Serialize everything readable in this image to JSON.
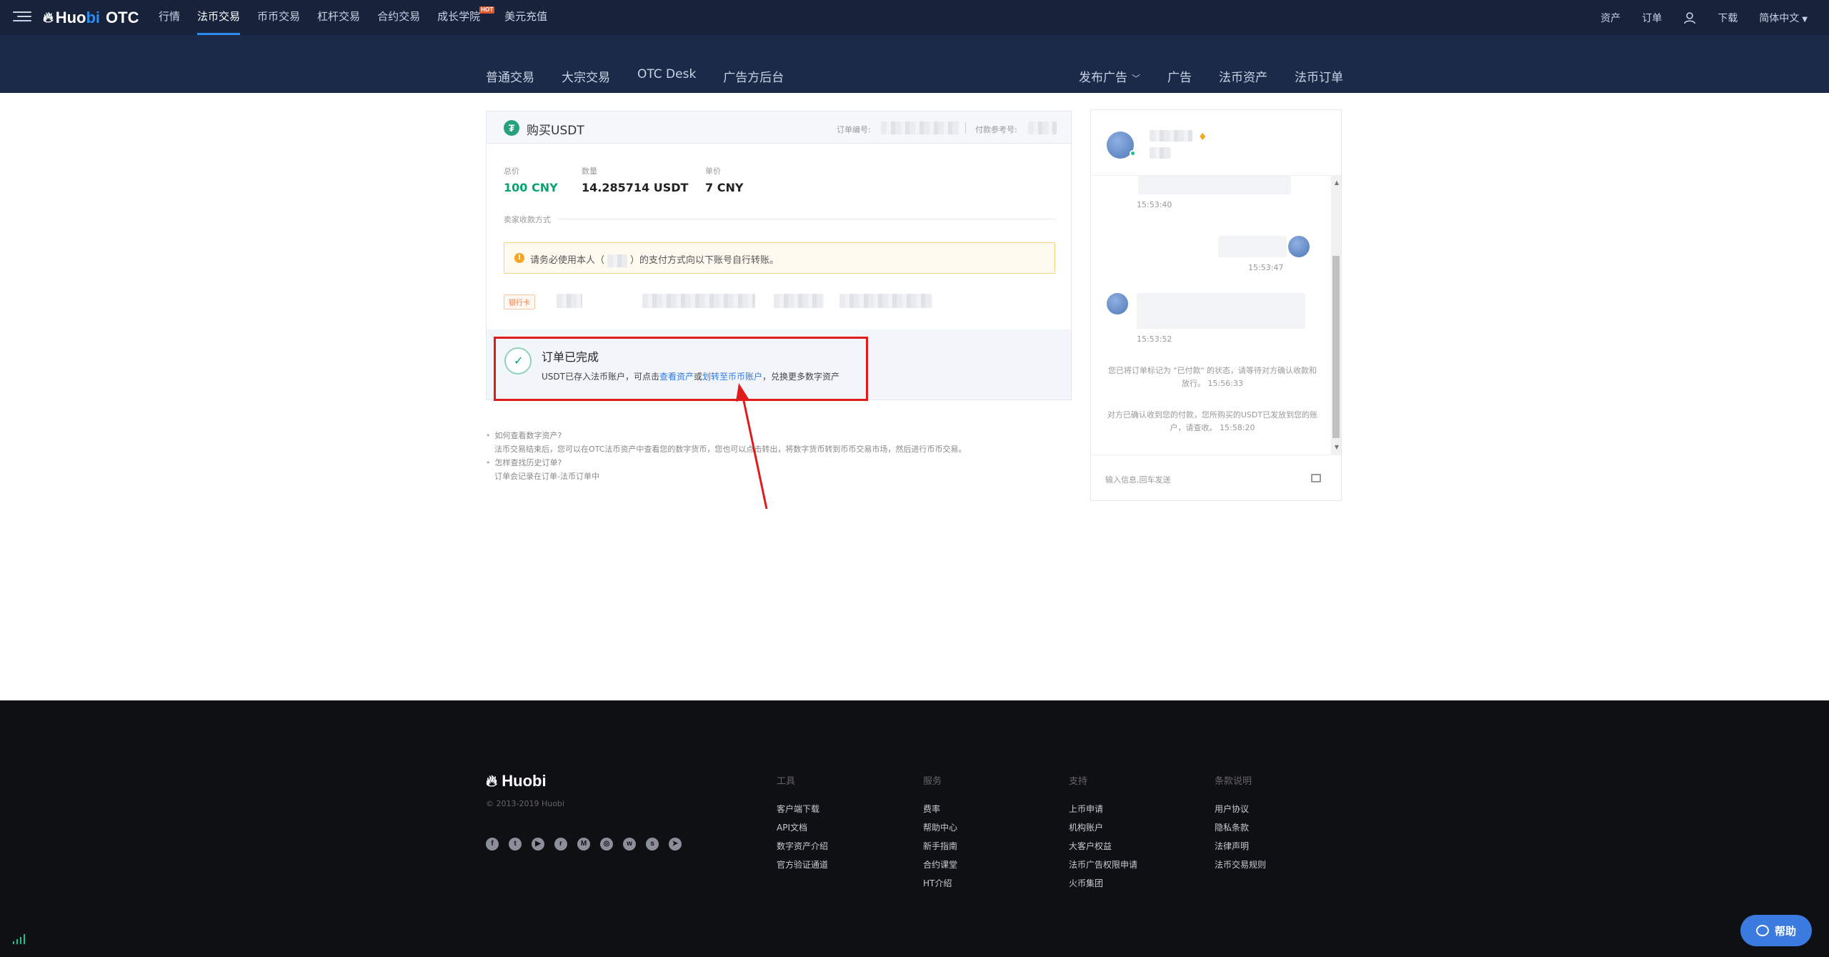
{
  "topnav": {
    "logo_main": "Huo",
    "logo_accent": "bi",
    "logo_suffix": "OTC",
    "items": [
      "行情",
      "法币交易",
      "币币交易",
      "杠杆交易",
      "合约交易",
      "成长学院",
      "美元充值"
    ],
    "hot_badge": "HOT",
    "right": {
      "assets": "资产",
      "orders": "订单",
      "download": "下载",
      "language": "简体中文"
    }
  },
  "subnav": {
    "left": [
      "普通交易",
      "大宗交易",
      "OTC Desk",
      "广告方后台"
    ],
    "right": [
      "发布广告",
      "广告",
      "法币资产",
      "法币订单"
    ]
  },
  "order": {
    "coin_symbol": "₮",
    "title": "购买USDT",
    "order_no_label": "订单编号:",
    "pay_ref_label": "付款参考号:",
    "total_label": "总价",
    "total_value": "100 CNY",
    "quantity_label": "数量",
    "quantity_value": "14.285714 USDT",
    "price_label": "单价",
    "price_value": "7 CNY",
    "method_label": "卖家收款方式",
    "warning_pre": "请务必使用本人（",
    "warning_post": "）的支付方式向以下账号自行转账。",
    "bank_tag": "银行卡",
    "complete_title": "订单已完成",
    "complete_desc_1": "USDT已存入法币账户，可点击",
    "complete_link_1": "查看资产",
    "complete_desc_2": "或",
    "complete_link_2": "划转至币币账户",
    "complete_desc_3": "，兑换更多数字资产"
  },
  "faq": [
    {
      "q": "如何查看数字资产?",
      "a": "法币交易结束后，您可以在OTC法币资产中查看您的数字货币，您也可以点击转出，将数字货币转到币币交易市场，然后进行币币交易。"
    },
    {
      "q": "怎样查找历史订单?",
      "a": "订单会记录在订单-法币订单中"
    }
  ],
  "chat": {
    "times": [
      "15:53:40",
      "15:53:47",
      "15:53:52"
    ],
    "system_1": "您已将订单标记为 \"已付款\" 的状态，请等待对方确认收款和放行。 15:56:33",
    "system_2": "对方已确认收到您的付款，您所购买的USDT已发放到您的账户，请查收。 15:58:20",
    "input_placeholder": "输入信息,回车发送"
  },
  "footer": {
    "logo": "Huobi",
    "copyright": "© 2013-2019 Huobi",
    "columns": [
      {
        "title": "工具",
        "items": [
          "客户端下载",
          "API文档",
          "数字资产介绍",
          "官方验证通道"
        ]
      },
      {
        "title": "服务",
        "items": [
          "费率",
          "帮助中心",
          "新手指南",
          "合约课堂",
          "HT介绍"
        ]
      },
      {
        "title": "支持",
        "items": [
          "上币申请",
          "机构账户",
          "大客户权益",
          "法币广告权限申请",
          "火币集团"
        ]
      },
      {
        "title": "条款说明",
        "items": [
          "用户协议",
          "隐私条款",
          "法律声明",
          "法币交易规则"
        ]
      }
    ],
    "socials": [
      "facebook-icon",
      "twitter-icon",
      "youtube-icon",
      "reddit-icon",
      "medium-icon",
      "instagram-icon",
      "weibo-icon",
      "steemit-icon",
      "telegram-icon"
    ]
  },
  "help_button": "帮助",
  "colors": {
    "nav_bg": "#17233b",
    "subnav_bg": "#1b2a49",
    "accent": "#2d8cf0",
    "green": "#03a66d",
    "highlight_red": "#e01b1b",
    "footer_bg": "#0f1014"
  }
}
